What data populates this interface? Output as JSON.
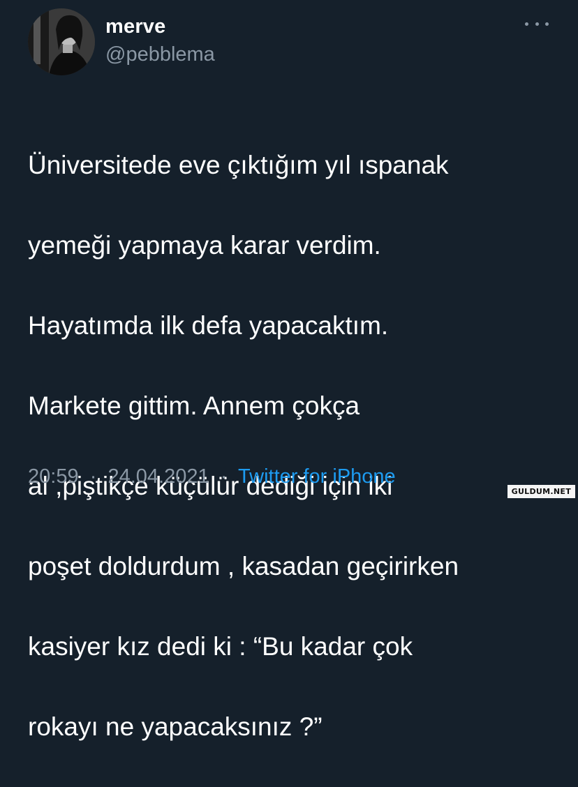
{
  "tweet": {
    "author": {
      "display_name": "merve",
      "handle": "@pebblema",
      "avatar_icon": "profile-photo"
    },
    "more_icon": "more-horizontal-icon",
    "text_lines": [
      "Üniversitede eve çıktığım yıl ıspanak",
      "yemeği yapmaya karar verdim.",
      "Hayatımda ilk defa yapacaktım.",
      "Markete gittim. Annem çokça",
      "al ,piştikçe küçülür dediği için iki",
      "poşet doldurdum , kasadan geçirirken",
      "kasiyer kız dedi ki : “Bu kadar çok",
      "rokayı ne yapacaksınız ?”"
    ],
    "time": "20:59",
    "date": "24.04.2021",
    "separator": "·",
    "source": "Twitter for iPhone"
  },
  "watermark": "GULDUM.NET",
  "colors": {
    "background": "#15202b",
    "text": "#ffffff",
    "secondary": "#8b98a5",
    "link": "#1d9bf0"
  }
}
